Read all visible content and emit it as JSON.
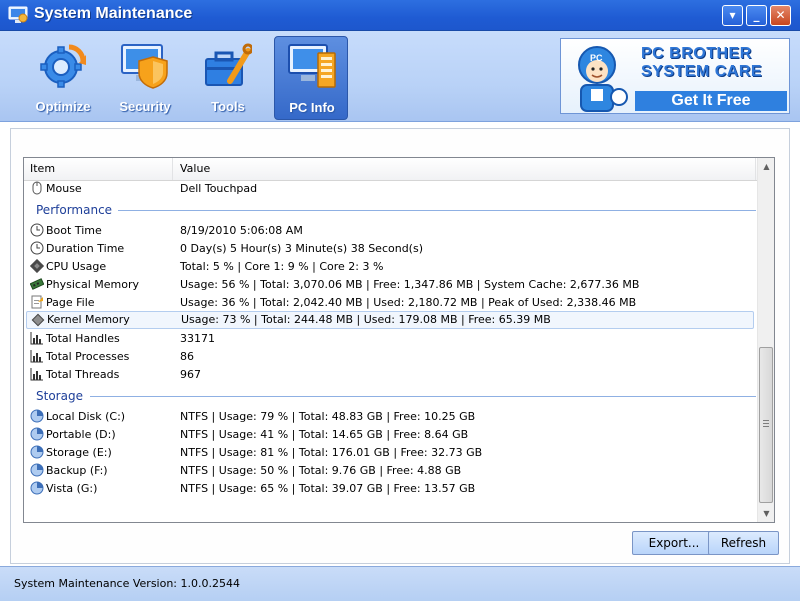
{
  "window": {
    "title": "System Maintenance"
  },
  "toolbar": {
    "tabs": [
      {
        "label": "Optimize",
        "icon": "gear-refresh-icon"
      },
      {
        "label": "Security",
        "icon": "shield-monitor-icon"
      },
      {
        "label": "Tools",
        "icon": "toolbox-icon"
      },
      {
        "label": "PC Info",
        "icon": "monitor-info-icon",
        "active": true
      }
    ]
  },
  "banner": {
    "line1": "PC BROTHER",
    "line2": "SYSTEM CARE",
    "cta": "Get It Free",
    "badge": "PC"
  },
  "list": {
    "columns": [
      "Item",
      "Value"
    ],
    "rows": [
      {
        "name": "Mouse",
        "value": "Dell Touchpad",
        "icon": "mouse-icon"
      }
    ],
    "performance_label": "Performance",
    "performance": [
      {
        "name": "Boot Time",
        "value": "8/19/2010 5:06:08 AM",
        "icon": "clock-icon"
      },
      {
        "name": "Duration Time",
        "value": "0 Day(s) 5 Hour(s) 3 Minute(s) 38 Second(s)",
        "icon": "clock-icon"
      },
      {
        "name": "CPU Usage",
        "value": "Total: 5 % | Core 1: 9 % | Core 2: 3 %",
        "icon": "cpu-icon"
      },
      {
        "name": "Physical Memory",
        "value": "Usage: 56 % | Total: 3,070.06 MB | Free: 1,347.86 MB | System Cache: 2,677.36 MB",
        "icon": "memory-icon"
      },
      {
        "name": "Page File",
        "value": "Usage: 36 % | Total: 2,042.40 MB | Used: 2,180.72 MB | Peak of Used: 2,338.46 MB",
        "icon": "page-file-icon"
      },
      {
        "name": "Kernel Memory",
        "value": "Usage: 73 % | Total: 244.48 MB | Used: 179.08 MB | Free: 65.39 MB",
        "icon": "kernel-icon",
        "selected": true
      },
      {
        "name": "Total Handles",
        "value": "33171",
        "icon": "bar-chart-icon"
      },
      {
        "name": "Total Processes",
        "value": "86",
        "icon": "bar-chart-icon"
      },
      {
        "name": "Total Threads",
        "value": "967",
        "icon": "bar-chart-icon"
      }
    ],
    "storage_label": "Storage",
    "storage": [
      {
        "name": "Local Disk (C:)",
        "value": "NTFS | Usage: 79 % | Total: 48.83 GB | Free: 10.25 GB",
        "icon": "disk-icon"
      },
      {
        "name": "Portable (D:)",
        "value": "NTFS | Usage: 41 % | Total: 14.65 GB | Free: 8.64 GB",
        "icon": "disk-icon"
      },
      {
        "name": "Storage (E:)",
        "value": "NTFS | Usage: 81 % | Total: 176.01 GB | Free: 32.73 GB",
        "icon": "disk-icon"
      },
      {
        "name": "Backup (F:)",
        "value": "NTFS | Usage: 50 % | Total: 9.76 GB | Free: 4.88 GB",
        "icon": "disk-icon"
      },
      {
        "name": "Vista (G:)",
        "value": "NTFS | Usage: 65 % | Total: 39.07 GB | Free: 13.57 GB",
        "icon": "disk-icon"
      }
    ]
  },
  "buttons": {
    "export": "Export...",
    "refresh": "Refresh"
  },
  "status": {
    "version": "System Maintenance Version: 1.0.0.2544"
  },
  "colors": {
    "titlebar": "#1f5bd3",
    "toolbar": "#b9d2f7",
    "group_text": "#1e3f99",
    "selection": "#f1f6fd"
  }
}
